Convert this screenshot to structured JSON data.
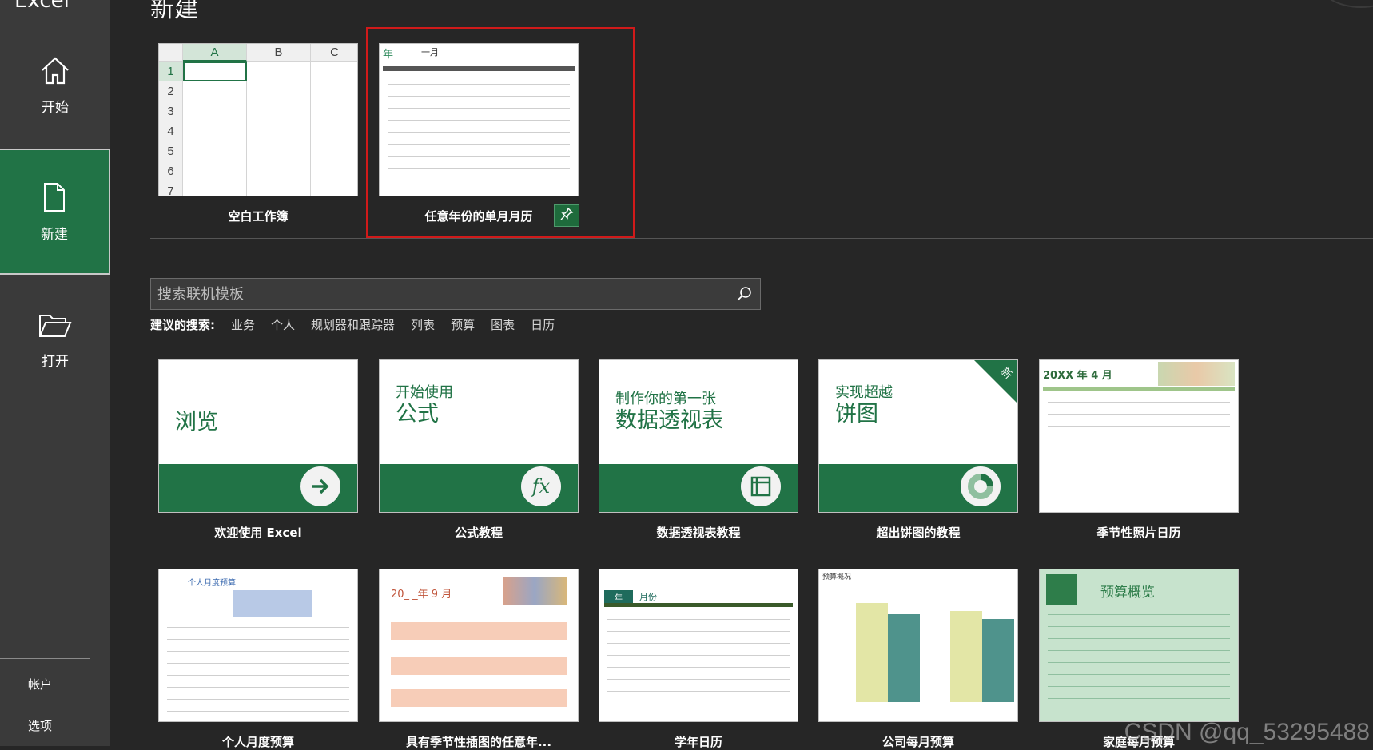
{
  "app": {
    "title": "Excel"
  },
  "sidebar": {
    "home": "开始",
    "new": "新建",
    "open": "打开",
    "account": "帐户",
    "options": "选项"
  },
  "main": {
    "title": "新建",
    "pinned": [
      {
        "label": "空白工作簿"
      },
      {
        "label": "任意年份的单月月历"
      }
    ],
    "search": {
      "placeholder": "搜索联机模板"
    },
    "suggest": {
      "label": "建议的搜索:",
      "items": [
        "业务",
        "个人",
        "规划器和跟踪器",
        "列表",
        "预算",
        "图表",
        "日历"
      ]
    },
    "sheet": {
      "cols": [
        "A",
        "B",
        "C"
      ],
      "rows": [
        "1",
        "2",
        "3",
        "4",
        "5",
        "6",
        "7"
      ]
    },
    "calendar_thumb": {
      "year": "年",
      "month": "一月"
    },
    "templates_row1": [
      {
        "label": "欢迎使用 Excel",
        "line1": "浏览",
        "line2": ""
      },
      {
        "label": "公式教程",
        "line1": "开始使用",
        "line2": "公式"
      },
      {
        "label": "数据透视表教程",
        "line1": "制作你的第一张",
        "line2": "数据透视表"
      },
      {
        "label": "超出饼图的教程",
        "line1": "实现超越",
        "line2": "饼图",
        "badge": "新"
      },
      {
        "label": "季节性照片日历",
        "header": "20XX 年 4 月"
      }
    ],
    "templates_row2": [
      {
        "label": "个人月度预算",
        "header": "个人月度预算"
      },
      {
        "label": "具有季节性插图的任意年...",
        "header": "20_ _年 9 月"
      },
      {
        "label": "学年日历",
        "header": "月份",
        "tag": "年"
      },
      {
        "label": "公司每月预算",
        "header": "预算概况"
      },
      {
        "label": "家庭每月预算",
        "header": "预算概览"
      }
    ]
  },
  "watermark": "CSDN @qq_53295488",
  "colors": {
    "accent": "#217346",
    "selection": "#d01a1a"
  }
}
